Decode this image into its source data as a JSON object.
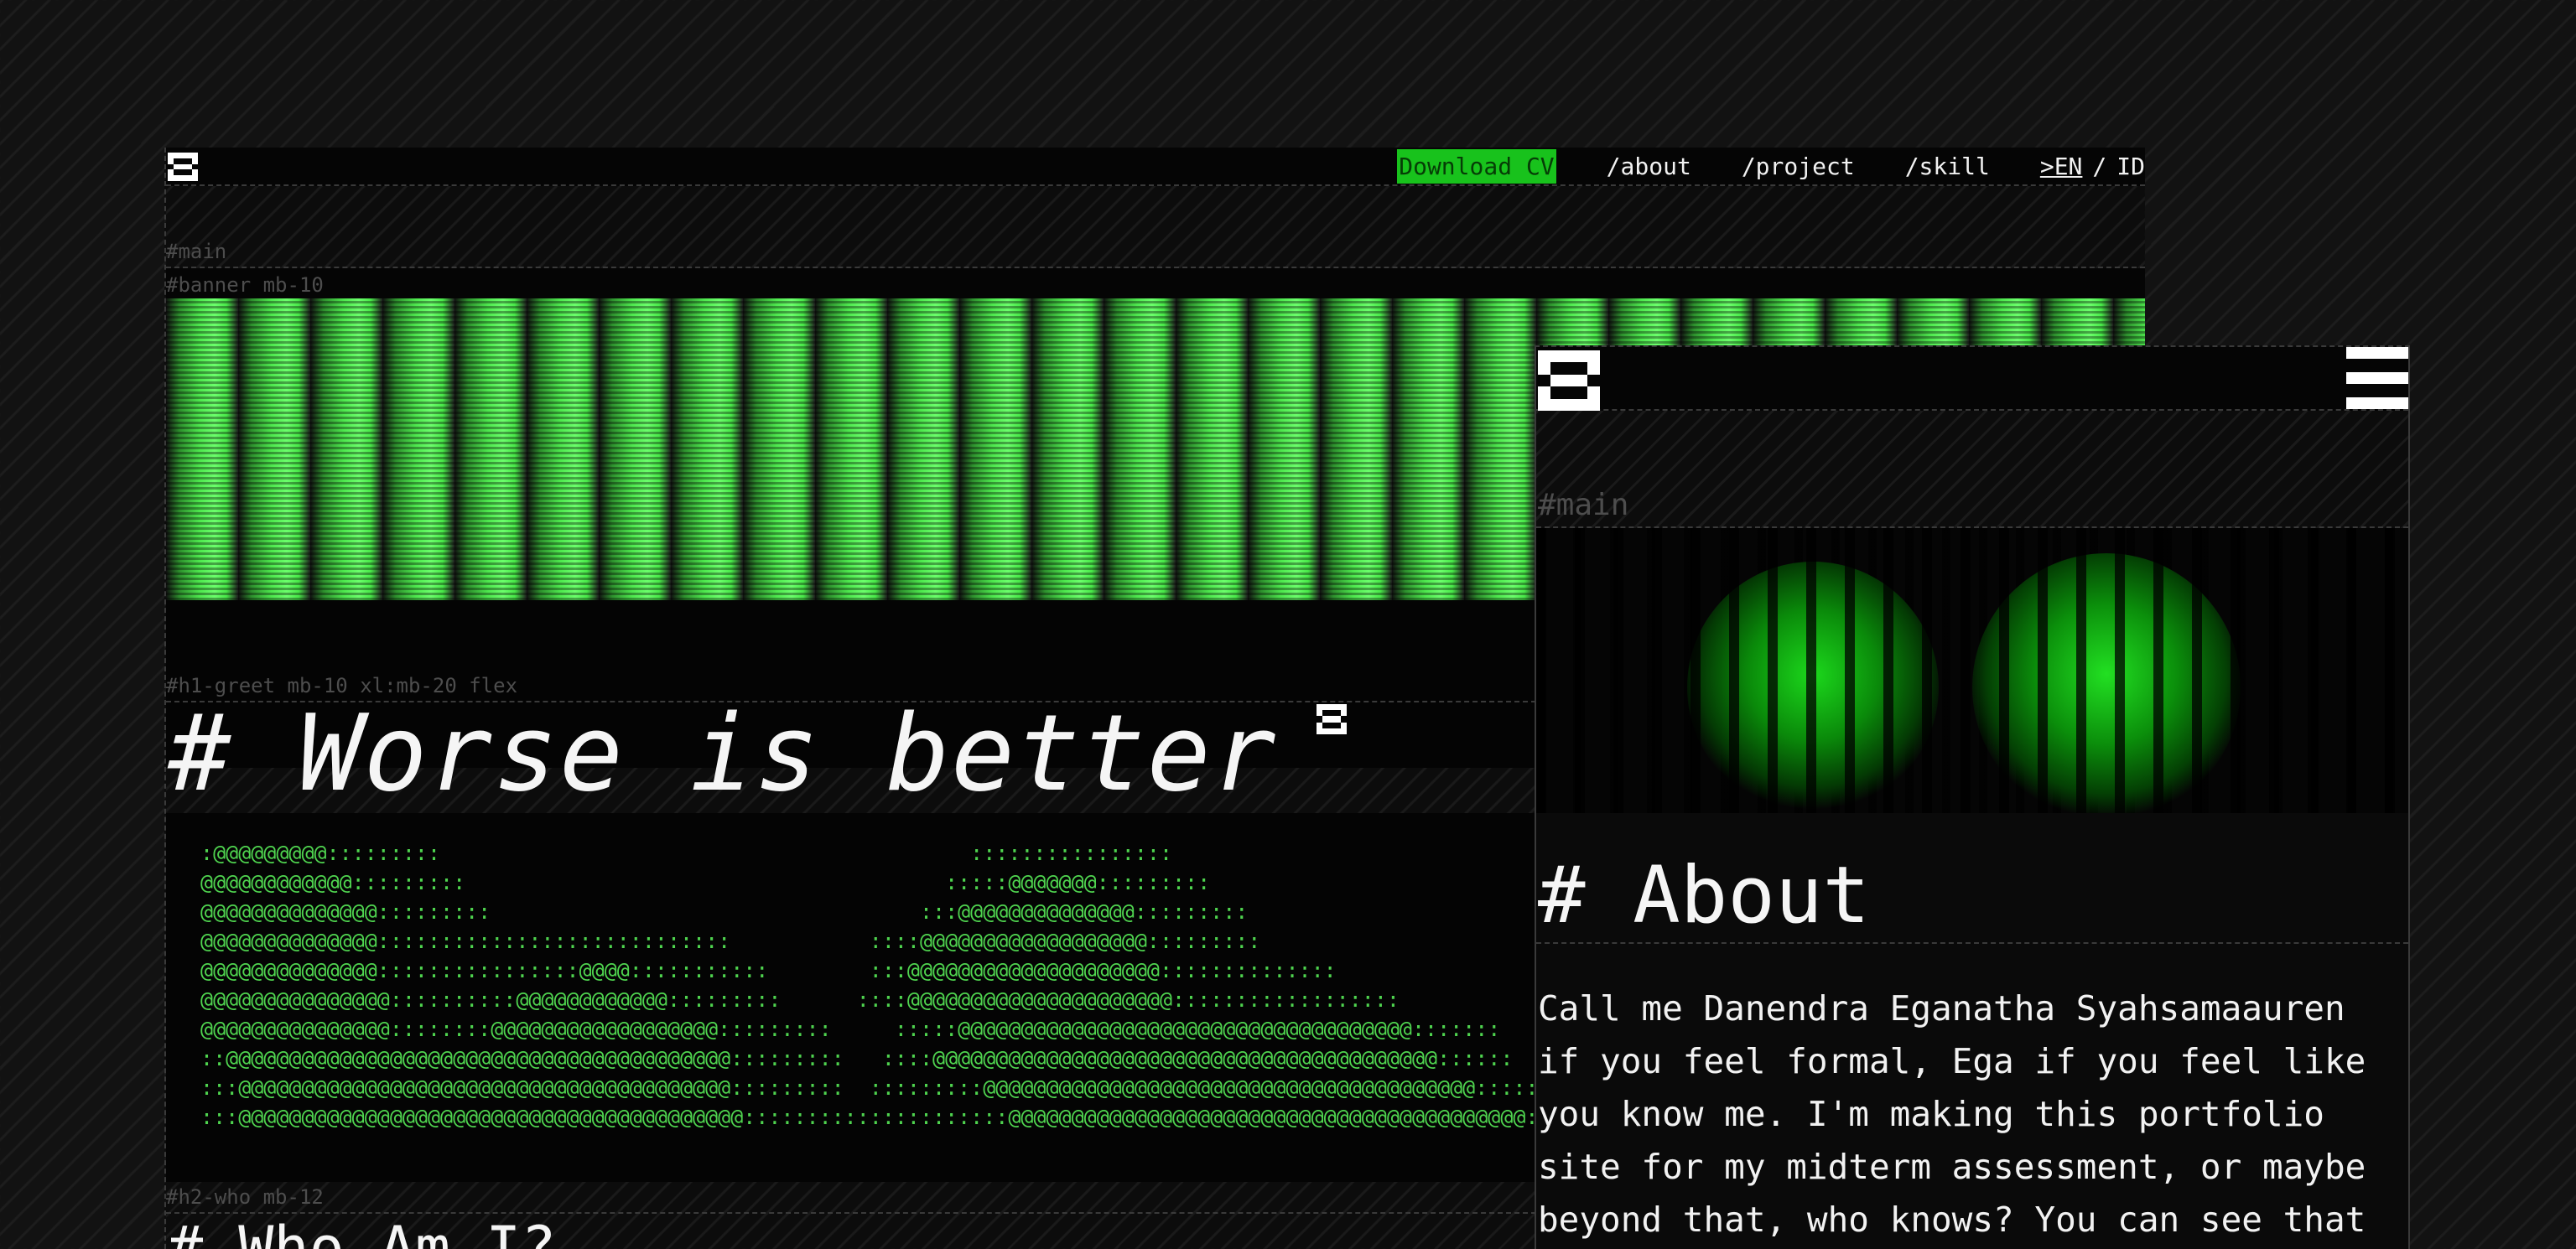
{
  "desktop": {
    "nav": {
      "logo_icon": "pixel-logo-icon",
      "download_cv": "Download CV",
      "links": [
        "/about",
        "/project",
        "/skill"
      ],
      "lang_active": ">EN",
      "lang_separator": "/",
      "lang_other": "ID"
    },
    "debug_labels": {
      "main": "#main",
      "banner": "#banner mb-10",
      "h1_greet": "#h1-greet mb-10 xl:mb-20 flex",
      "h2_who": "#h2-who mb-12"
    },
    "headline": "# Worse is better",
    "ascii_art": " :@@@@@@@@@:::::::::                                          ::::::::::::::::\n @@@@@@@@@@@@:::::::::                                      :::::@@@@@@@:::::::::\n @@@@@@@@@@@@@@:::::::::                                  :::@@@@@@@@@@@@@@:::::::::\n @@@@@@@@@@@@@@::::::::::::::::::::::::::::           ::::@@@@@@@@@@@@@@@@@@:::::::::\n @@@@@@@@@@@@@@::::::::::::::::@@@@:::::::::::        :::@@@@@@@@@@@@@@@@@@@@::::::::::::::\n @@@@@@@@@@@@@@@::::::::::@@@@@@@@@@@@:::::::::      ::::@@@@@@@@@@@@@@@@@@@@@::::::::::::::::::\n @@@@@@@@@@@@@@@::::::::@@@@@@@@@@@@@@@@@@:::::::::     :::::@@@@@@@@@@@@@@@@@@@@@@@@@@@@@@@@@@@@:::::::\n ::@@@@@@@@@@@@@@@@@@@@@@@@@@@@@@@@@@@@@@@@:::::::::   ::::@@@@@@@@@@@@@@@@@@@@@@@@@@@@@@@@@@@@@@@@::::::\n :::@@@@@@@@@@@@@@@@@@@@@@@@@@@@@@@@@@@@@@@:::::::::  :::::::::@@@@@@@@@@@@@@@@@@@@@@@@@@@@@@@@@@@@@@@::::::\n :::@@@@@@@@@@@@@@@@@@@@@@@@@@@@@@@@@@@@@@@@:::::::::::::::::::::@@@@@@@@@@@@@@@@@@@@@@@@@@@@@@@@@@@@@@@@@::::::",
    "section_title": "# Who Am I?"
  },
  "mobile": {
    "logo_icon": "pixel-logo-icon",
    "menu_icon": "hamburger-menu-icon",
    "debug_main": "#main",
    "section_title": "# About",
    "about_text": "Call me Danendra Eganatha Syahsamaauren\nif you feel formal, Ega if you feel like\nyou know me. I'm making this portfolio\nsite for my midterm assessment, or maybe\nbeyond that, who knows? You can see that"
  },
  "colors": {
    "accent_green": "#18c21c",
    "ascii_green": "#4fd44f",
    "background": "#121212",
    "text": "#f2f2f2"
  }
}
